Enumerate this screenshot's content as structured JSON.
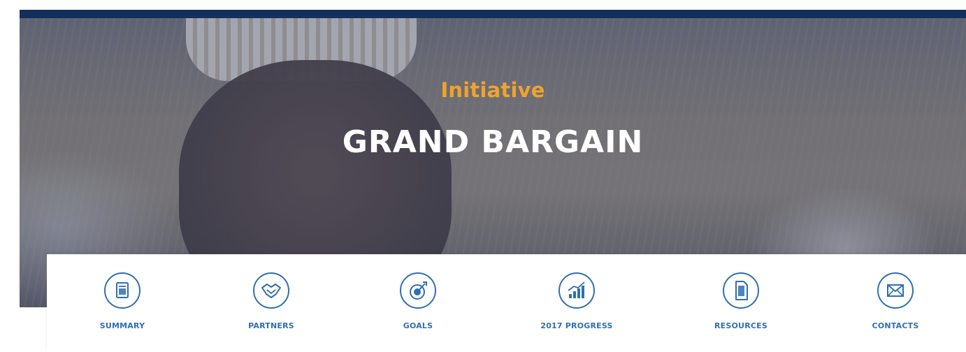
{
  "hero": {
    "kicker": "Initiative",
    "title": "GRAND BARGAIN"
  },
  "nav": {
    "items": [
      {
        "label": "SUMMARY",
        "icon": "document-icon"
      },
      {
        "label": "PARTNERS",
        "icon": "handshake-icon"
      },
      {
        "label": "GOALS",
        "icon": "target-icon"
      },
      {
        "label": "2017 PROGRESS",
        "icon": "bar-chart-icon"
      },
      {
        "label": "RESOURCES",
        "icon": "file-icon"
      },
      {
        "label": "CONTACTS",
        "icon": "envelope-icon"
      }
    ]
  },
  "colors": {
    "top_bar": "#13305c",
    "kicker": "#f0a32b",
    "nav_accent": "#2f6fb3"
  }
}
